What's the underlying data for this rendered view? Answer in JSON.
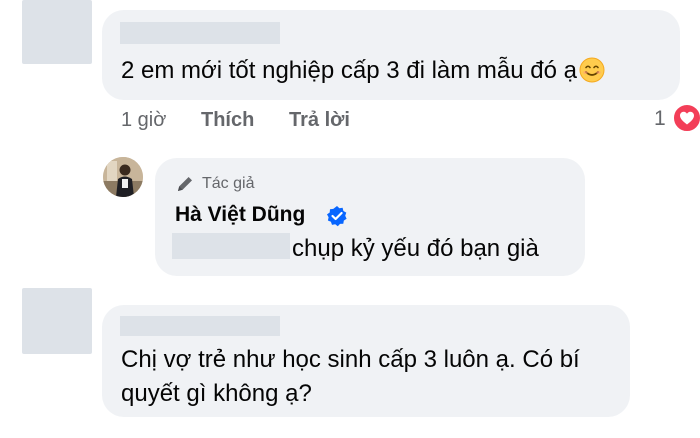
{
  "comment1": {
    "text": "2 em mới tốt nghiệp cấp 3 đi làm mẫu đó ạ",
    "emoji": "smiling-face-icon",
    "time": "1 giờ",
    "like_label": "Thích",
    "reply_label": "Trả lời",
    "reaction_count": "1",
    "reaction_icon": "heart-icon"
  },
  "reply": {
    "author_tag": "Tác giả",
    "author_name": "Hà Việt Dũng",
    "text": "chụp kỷ yếu đó bạn già"
  },
  "comment2": {
    "text_line1": "Chị vợ trẻ như học sinh cấp 3 luôn ạ. Có bí",
    "text_line2": "quyết gì không ạ?"
  },
  "colors": {
    "bubble": "#f0f2f5",
    "redaction": "#dde2e8",
    "secondary_text": "#65676b",
    "verified_blue": "#0866ff",
    "heart_red": "#f33e58"
  }
}
